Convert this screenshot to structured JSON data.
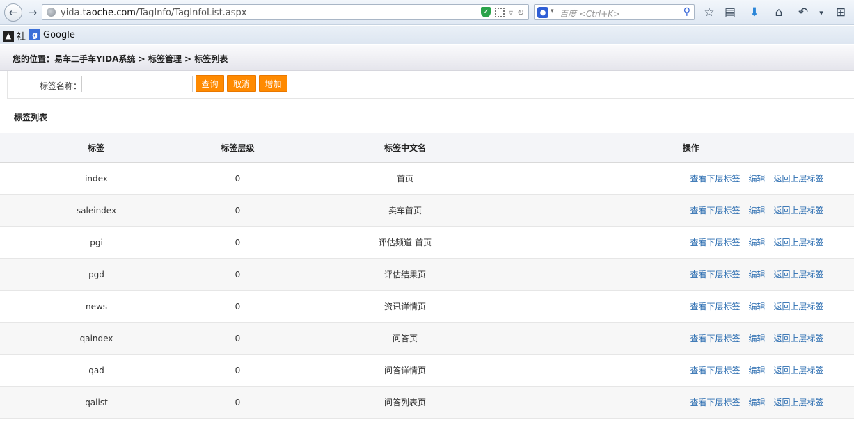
{
  "browser": {
    "url_prefix": "yida.",
    "url_host": "taoche.com",
    "url_path": "/TagInfo/TagInfoList.aspx",
    "search_placeholder": "百度 <Ctrl+K>",
    "bookmarks": [
      {
        "label": "社"
      },
      {
        "label": "Google"
      }
    ]
  },
  "breadcrumb": {
    "text": "您的位置：易车二手车YIDA系统 > 标签管理 > 标签列表"
  },
  "filter": {
    "label": "标签名称：",
    "input_value": "",
    "buttons": {
      "query": "查询",
      "cancel": "取消",
      "add": "增加"
    }
  },
  "section_title": "标签列表",
  "table": {
    "headers": [
      "标签",
      "标签层级",
      "标签中文名",
      "操作"
    ],
    "row_actions": [
      "查看下层标签",
      "编辑",
      "返回上层标签"
    ],
    "rows": [
      {
        "tag": "index",
        "level": "0",
        "cn_name": "首页"
      },
      {
        "tag": "saleindex",
        "level": "0",
        "cn_name": "卖车首页"
      },
      {
        "tag": "pgi",
        "level": "0",
        "cn_name": "评估频道-首页"
      },
      {
        "tag": "pgd",
        "level": "0",
        "cn_name": "评估结果页"
      },
      {
        "tag": "news",
        "level": "0",
        "cn_name": "资讯详情页"
      },
      {
        "tag": "qaindex",
        "level": "0",
        "cn_name": "问答页"
      },
      {
        "tag": "qad",
        "level": "0",
        "cn_name": "问答详情页"
      },
      {
        "tag": "qalist",
        "level": "0",
        "cn_name": "问答列表页"
      }
    ]
  },
  "colors": {
    "button_orange": "#ff8a00",
    "link_blue": "#2a6cb0",
    "header_bg": "#f4f5f8",
    "alt_row_bg": "#f7f7f7"
  }
}
